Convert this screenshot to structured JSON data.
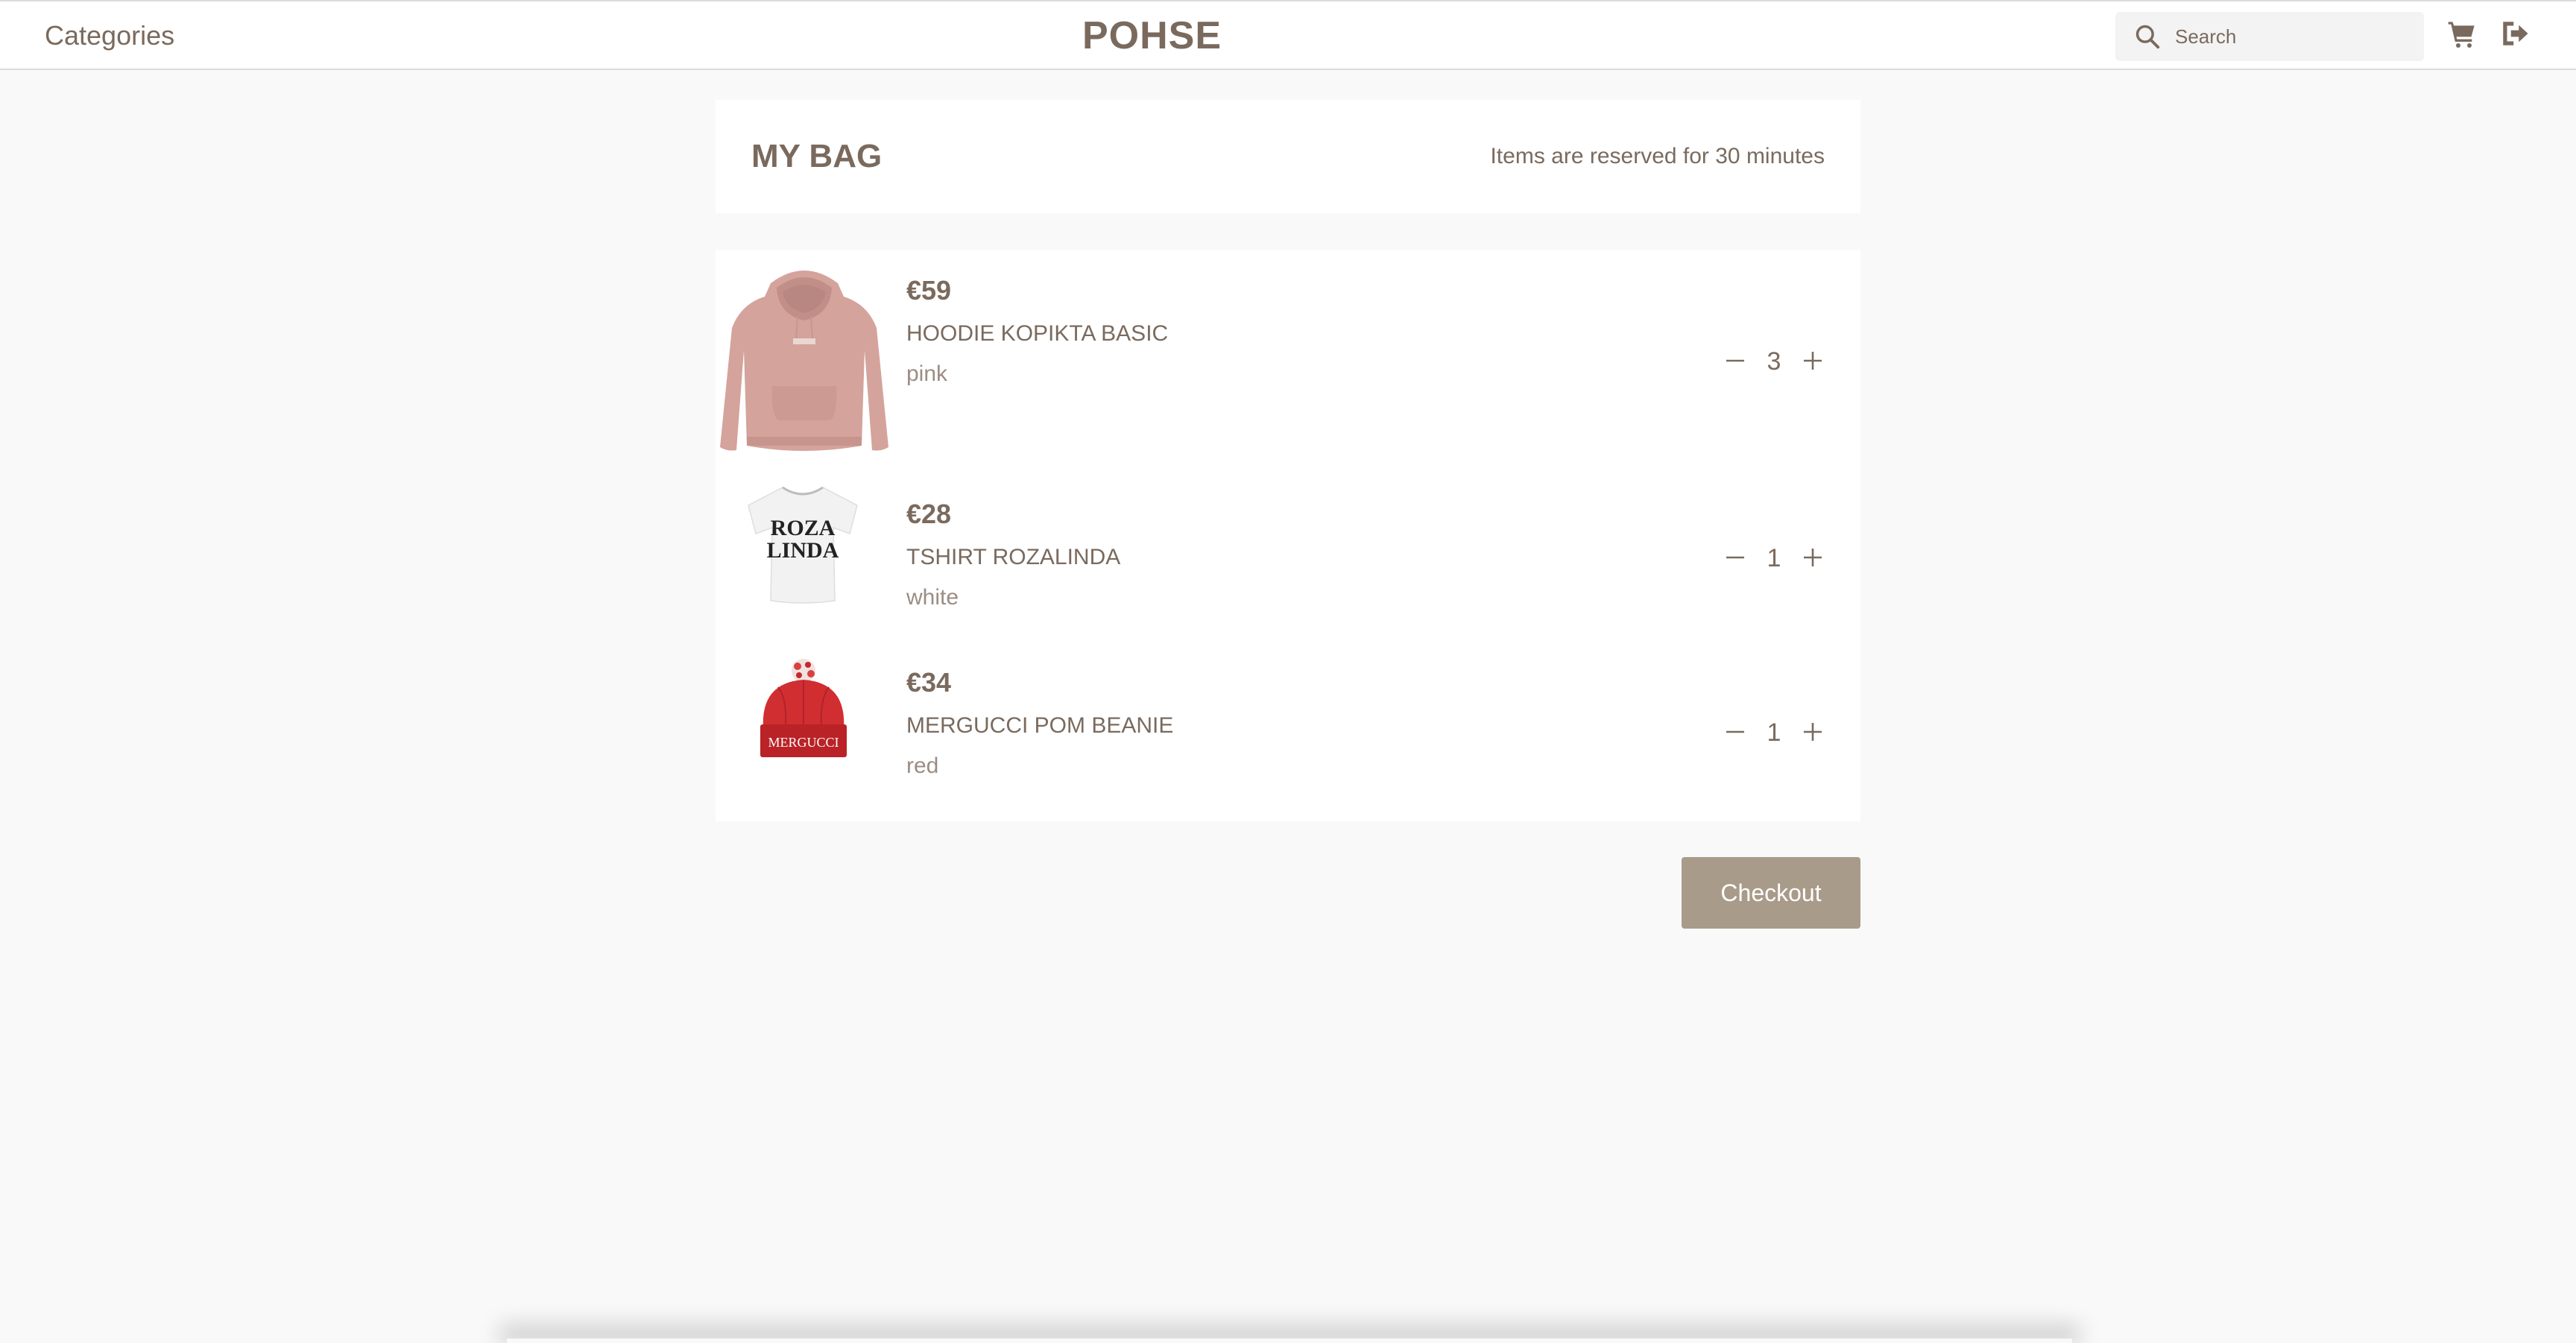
{
  "header": {
    "categories_label": "Categories",
    "brand": "POHSE",
    "search_placeholder": "Search",
    "icons": [
      "search-icon",
      "cart-icon",
      "logout-icon"
    ]
  },
  "bag": {
    "title": "MY BAG",
    "reserve_note": "Items are reserved for 30 minutes"
  },
  "items": [
    {
      "price": "€59",
      "name": "HOODIE KOPIKTA BASIC",
      "color": "pink",
      "quantity": "3"
    },
    {
      "price": "€28",
      "name": "TSHIRT ROZALINDA",
      "color": "white",
      "quantity": "1"
    },
    {
      "price": "€34",
      "name": "MERGUCCI POM BEANIE",
      "color": "red",
      "quantity": "1"
    }
  ],
  "product_artwork": {
    "hoodie_print": "",
    "tshirt_print_line1": "ROZA",
    "tshirt_print_line2": "LINDA",
    "beanie_print": "MERGUCCI"
  },
  "checkout_label": "Checkout",
  "colors": {
    "text": "#7a6a5e",
    "background": "#f9f9f9",
    "checkout_button": "#a99b89",
    "hoodie": "#d4a39c",
    "beanie": "#c8262b"
  }
}
